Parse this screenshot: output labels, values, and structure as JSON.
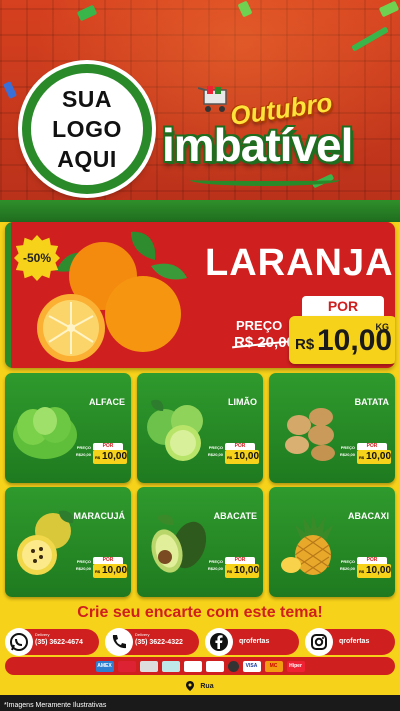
{
  "logo": {
    "line1": "SUA",
    "line2": "LOGO",
    "line3": "AQUI"
  },
  "header": {
    "title_top": "Outubro",
    "title_main": "imbatível"
  },
  "featured": {
    "discount": "-50%",
    "name": "LARANJA",
    "por_label": "POR",
    "preco_label": "PREÇO",
    "old_price": "R$ 20,00",
    "currency": "R$",
    "price": "10,00",
    "unit": "KG"
  },
  "products": [
    {
      "name": "ALFACE",
      "por": "POR",
      "preco": "PREÇO",
      "old": "R$20,00",
      "currency": "R$",
      "price": "10,00",
      "icon": "lettuce-icon"
    },
    {
      "name": "LIMÃO",
      "por": "POR",
      "preco": "PREÇO",
      "old": "R$20,00",
      "currency": "R$",
      "price": "10,00",
      "icon": "lime-icon"
    },
    {
      "name": "BATATA",
      "por": "POR",
      "preco": "PREÇO",
      "old": "R$20,00",
      "currency": "R$",
      "price": "10,00",
      "icon": "potato-icon"
    },
    {
      "name": "MARACUJÁ",
      "por": "POR",
      "preco": "PREÇO",
      "old": "R$20,00",
      "currency": "R$",
      "price": "10,00",
      "icon": "passion-fruit-icon"
    },
    {
      "name": "ABACATE",
      "por": "POR",
      "preco": "PREÇO",
      "old": "R$20,00",
      "currency": "R$",
      "price": "10,00",
      "icon": "avocado-icon"
    },
    {
      "name": "ABACAXI",
      "por": "POR",
      "preco": "PREÇO",
      "old": "R$20,00",
      "currency": "R$",
      "price": "10,00",
      "icon": "pineapple-icon"
    }
  ],
  "cta": "Crie seu encarte com este tema!",
  "contacts": {
    "whatsapp": {
      "label": "Delivery",
      "phone": "(35) 3622-4674"
    },
    "phone": {
      "label": "Delivery",
      "phone": "(35) 3622-4322"
    },
    "facebook": "qrofertas",
    "instagram": "qrofertas"
  },
  "payments": [
    "AMEX",
    "",
    "",
    "",
    "",
    "",
    "",
    "VISA",
    "MC",
    "Hiper"
  ],
  "address": "Rua",
  "disclaimer": "*Imagens Meramente Ilustrativas",
  "colors": {
    "red": "#cf1f1f",
    "green": "#2a8a2a",
    "yellow": "#f7d21a"
  }
}
